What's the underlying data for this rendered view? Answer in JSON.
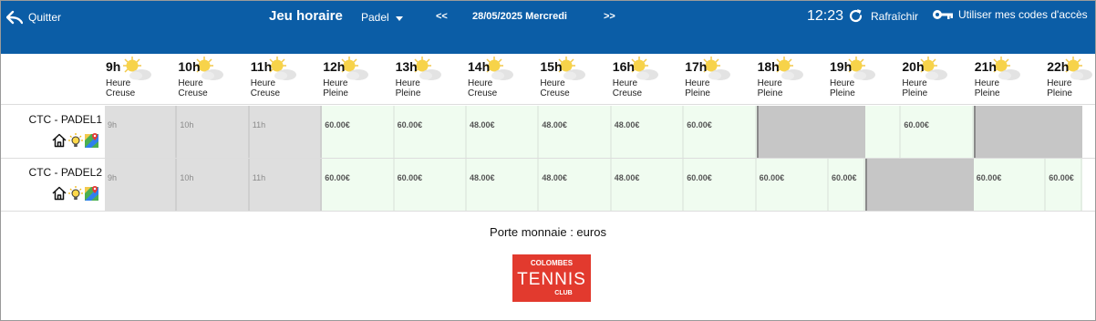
{
  "header": {
    "quit_label": "Quitter",
    "title": "Jeu horaire",
    "sport": "Padel",
    "prev": "<<",
    "date": "28/05/2025 Mercredi",
    "next": ">>",
    "time": "12:23",
    "refresh_label": "Rafraîchir",
    "codes_label": "Utiliser mes codes d'accès",
    "bg_color": "#0b5da6"
  },
  "hours": [
    {
      "label": "9h",
      "type1": "Heure",
      "type2": "Creuse"
    },
    {
      "label": "10h",
      "type1": "Heure",
      "type2": "Creuse"
    },
    {
      "label": "11h",
      "type1": "Heure",
      "type2": "Creuse"
    },
    {
      "label": "12h",
      "type1": "Heure",
      "type2": "Pleine"
    },
    {
      "label": "13h",
      "type1": "Heure",
      "type2": "Pleine"
    },
    {
      "label": "14h",
      "type1": "Heure",
      "type2": "Creuse"
    },
    {
      "label": "15h",
      "type1": "Heure",
      "type2": "Creuse"
    },
    {
      "label": "16h",
      "type1": "Heure",
      "type2": "Creuse"
    },
    {
      "label": "17h",
      "type1": "Heure",
      "type2": "Pleine"
    },
    {
      "label": "18h",
      "type1": "Heure",
      "type2": "Pleine"
    },
    {
      "label": "19h",
      "type1": "Heure",
      "type2": "Pleine"
    },
    {
      "label": "20h",
      "type1": "Heure",
      "type2": "Pleine"
    },
    {
      "label": "21h",
      "type1": "Heure",
      "type2": "Pleine"
    },
    {
      "label": "22h",
      "type1": "Heure",
      "type2": "Pleine"
    }
  ],
  "courts": [
    {
      "name": "CTC - PADEL1",
      "icons": [
        "house-icon",
        "lightbulb-icon",
        "map-icon"
      ],
      "slots": [
        {
          "status": "past",
          "label": "9h",
          "start": 9,
          "end": 10
        },
        {
          "status": "past",
          "label": "10h",
          "start": 10,
          "end": 11
        },
        {
          "status": "past",
          "label": "11h",
          "start": 11,
          "end": 12
        },
        {
          "status": "free",
          "label": "60.00€",
          "start": 12,
          "end": 13
        },
        {
          "status": "free",
          "label": "60.00€",
          "start": 13,
          "end": 14
        },
        {
          "status": "free",
          "label": "48.00€",
          "start": 14,
          "end": 15
        },
        {
          "status": "free",
          "label": "48.00€",
          "start": 15,
          "end": 16
        },
        {
          "status": "free",
          "label": "48.00€",
          "start": 16,
          "end": 17
        },
        {
          "status": "free",
          "label": "60.00€",
          "start": 17,
          "end": 18
        },
        {
          "status": "busy",
          "label": "",
          "start": 18,
          "end": 19.5
        },
        {
          "status": "free",
          "label": "",
          "start": 19.5,
          "end": 20
        },
        {
          "status": "free",
          "label": "60.00€",
          "start": 20,
          "end": 21
        },
        {
          "status": "busy",
          "label": "",
          "start": 21,
          "end": 22.5
        }
      ]
    },
    {
      "name": "CTC - PADEL2",
      "icons": [
        "house-icon",
        "lightbulb-icon",
        "map-icon"
      ],
      "slots": [
        {
          "status": "past",
          "label": "9h",
          "start": 9,
          "end": 10
        },
        {
          "status": "past",
          "label": "10h",
          "start": 10,
          "end": 11
        },
        {
          "status": "past",
          "label": "11h",
          "start": 11,
          "end": 12
        },
        {
          "status": "free",
          "label": "60.00€",
          "start": 12,
          "end": 13
        },
        {
          "status": "free",
          "label": "60.00€",
          "start": 13,
          "end": 14
        },
        {
          "status": "free",
          "label": "48.00€",
          "start": 14,
          "end": 15
        },
        {
          "status": "free",
          "label": "48.00€",
          "start": 15,
          "end": 16
        },
        {
          "status": "free",
          "label": "48.00€",
          "start": 16,
          "end": 17
        },
        {
          "status": "free",
          "label": "60.00€",
          "start": 17,
          "end": 18
        },
        {
          "status": "free",
          "label": "60.00€",
          "start": 18,
          "end": 19
        },
        {
          "status": "free",
          "label": "60.00€",
          "start": 19,
          "end": 19.5
        },
        {
          "status": "busy",
          "label": "",
          "start": 19.5,
          "end": 21
        },
        {
          "status": "free",
          "label": "60.00€",
          "start": 21,
          "end": 22
        },
        {
          "status": "free",
          "label": "60.00€",
          "start": 22,
          "end": 22.5
        }
      ]
    }
  ],
  "wallet": "Porte monnaie : euros",
  "logo": {
    "line1": "COLOMBES",
    "line2": "TENNIS",
    "line3": "CLUB",
    "color": "#e23a2e"
  },
  "colors": {
    "past": "#dedede",
    "free": "#f0fcf0",
    "busy": "#c6c6c6"
  }
}
